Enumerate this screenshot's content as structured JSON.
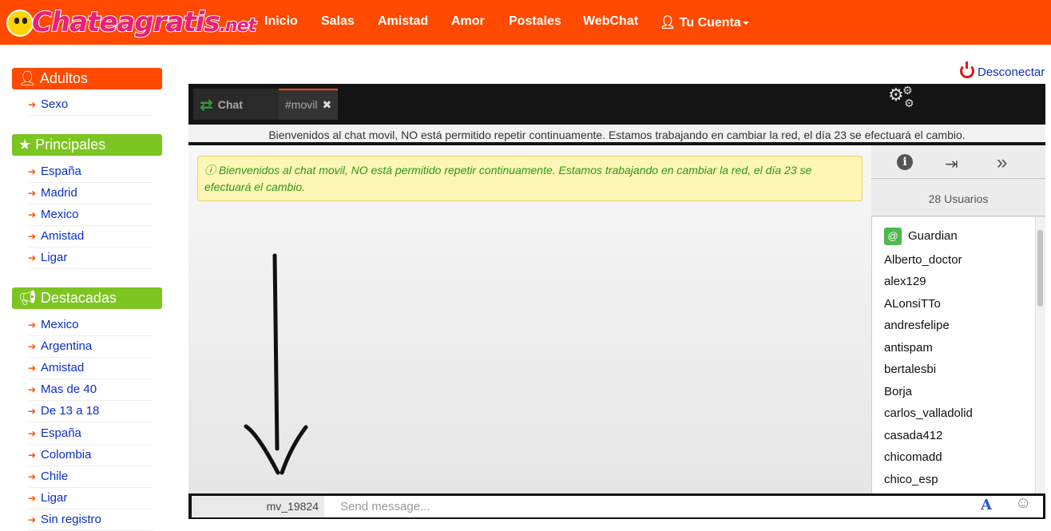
{
  "header": {
    "logo_main": "Chateagratis",
    "logo_tld": ".net",
    "nav": [
      "Inicio",
      "Salas",
      "Amistad",
      "Amor",
      "Postales",
      "WebChat"
    ],
    "account": "Tu Cuenta"
  },
  "sidebar": {
    "sections": [
      {
        "title": "Adultos",
        "icon": "user-icon",
        "items": [
          "Sexo"
        ]
      },
      {
        "title": "Principales",
        "icon": "star-icon",
        "items": [
          "España",
          "Madrid",
          "Mexico",
          "Amistad",
          "Ligar"
        ]
      },
      {
        "title": "Destacadas",
        "icon": "megaphone-icon",
        "items": [
          "Mexico",
          "Argentina",
          "Amistad",
          "Mas de 40",
          "De 13 a 18",
          "España",
          "Colombia",
          "Chile",
          "Ligar",
          "Sin registro"
        ]
      }
    ]
  },
  "disconnect": "Desconectar",
  "chat": {
    "tab_chat": "Chat",
    "tab_room": "#movil",
    "welcome": "Bienvenidos al chat movil, NO está permitido repetir continuamente. Estamos trabajando en cambiar la red, el día 23 se efectuará el cambio.",
    "alert_icon": "ⓘ",
    "alert": "Bienvenidos al chat movil, NO está permitido repetir continuamente. Estamos trabajando en cambiar la red, el día 23 se efectuará el cambio."
  },
  "users": {
    "count_label": "28 Usuarios",
    "operator_badge": "@",
    "list": [
      "Guardian",
      "Alberto_doctor",
      "alex129",
      "ALonsiTTo",
      "andresfelipe",
      "antispam",
      "bertalesbi",
      "Borja",
      "carlos_valladolid",
      "casada412",
      "chicomadd",
      "chico_esp"
    ]
  },
  "composer": {
    "nick": "mv_19824",
    "placeholder": "Send message...",
    "font_label": "A"
  },
  "colors": {
    "brand_orange": "#ff4a00",
    "section_green": "#7dc520",
    "link_blue": "#0b2fc4",
    "chat_dark": "#141414"
  }
}
